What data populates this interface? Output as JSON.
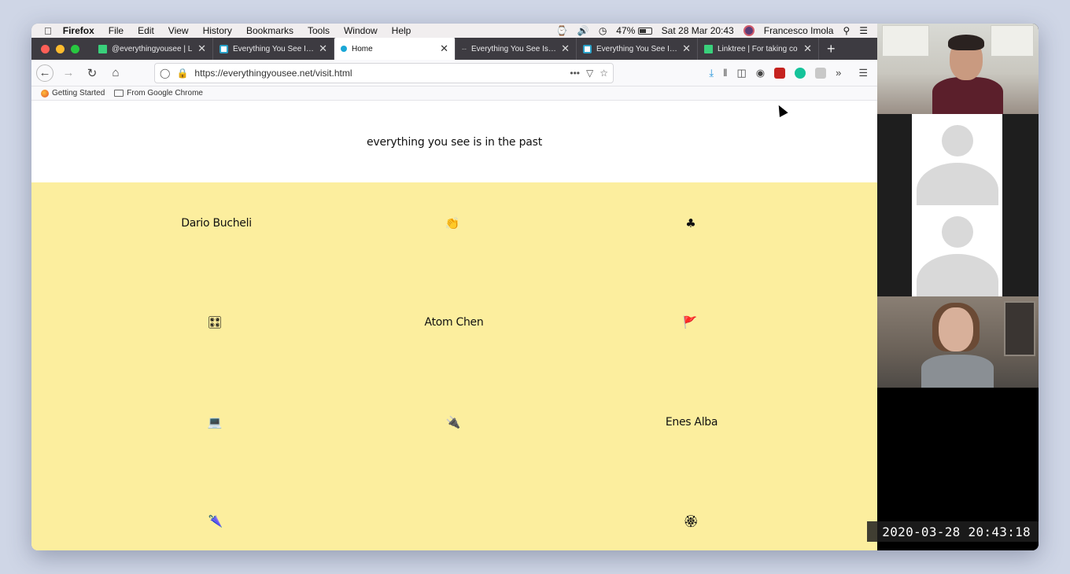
{
  "menubar": {
    "apple": "",
    "app": "Firefox",
    "items": [
      "File",
      "Edit",
      "View",
      "History",
      "Bookmarks",
      "Tools",
      "Window",
      "Help"
    ],
    "battery": "47%",
    "datetime": "Sat 28 Mar  20:43",
    "user": "Francesco Imola"
  },
  "tabs": [
    {
      "label": "@everythingyousee | L",
      "favicon": "linktree"
    },
    {
      "label": "Everything You See Is In",
      "favicon": "eyesee"
    },
    {
      "label": "Home",
      "favicon": "dot",
      "active": true
    },
    {
      "label": "Everything You See Is In",
      "favicon": "dash"
    },
    {
      "label": "Everything You See Is In",
      "favicon": "eyesee"
    },
    {
      "label": "Linktree | For taking co",
      "favicon": "linktree"
    }
  ],
  "toolbar": {
    "url": "https://everythingyousee.net/visit.html",
    "more": "•••"
  },
  "bookmarks": [
    {
      "label": "Getting Started",
      "icon": "firefox-icon"
    },
    {
      "label": "From Google Chrome",
      "icon": "folder-icon"
    }
  ],
  "page": {
    "title": "everything you see is in the past",
    "grid": [
      {
        "text": "Dario Bucheli",
        "kind": "name"
      },
      {
        "text": "👏",
        "kind": "emoji"
      },
      {
        "text": "♣",
        "kind": "emoji"
      },
      {
        "text": "🎛",
        "kind": "emoji"
      },
      {
        "text": "Atom Chen",
        "kind": "name"
      },
      {
        "text": "🚩",
        "kind": "emoji"
      },
      {
        "text": "💻",
        "kind": "emoji"
      },
      {
        "text": "🔌",
        "kind": "emoji"
      },
      {
        "text": "Enes Alba",
        "kind": "name"
      },
      {
        "text": "🌂",
        "kind": "emoji"
      },
      {
        "text": "",
        "kind": "empty"
      },
      {
        "text": "🏵",
        "kind": "emoji"
      }
    ],
    "background": "#fcee9e"
  },
  "video": {
    "timestamp": "2020-03-28  20:43:18"
  },
  "colors": {
    "close": "#fe5f57",
    "minimize": "#febc2e",
    "zoom": "#28c840",
    "grid_bg": "#fcee9e"
  }
}
